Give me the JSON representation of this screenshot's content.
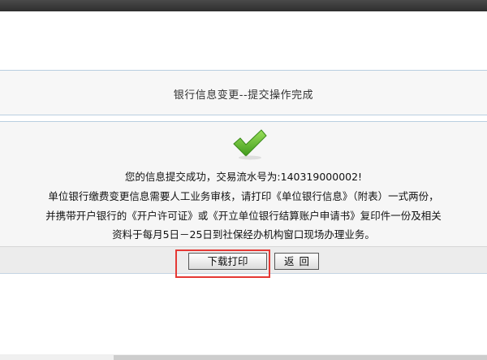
{
  "page": {
    "title": "银行信息变更--提交操作完成"
  },
  "result": {
    "line1": "您的信息提交成功，交易流水号为:140319000002!",
    "line2": "单位银行缴费变更信息需要人工业务审核，请打印《单位银行信息》（附表）一式两份，",
    "line3": "并携带开户银行的《开户许可证》或《开立单位银行结算账户申请书》复印件一份及相关",
    "line4": "资料于每月5日－25日到社保经办机构窗口现场办理业务。"
  },
  "buttons": {
    "download_print": "下载打印",
    "back": "返回"
  },
  "icons": {
    "success": "checkmark-icon"
  },
  "colors": {
    "check_green": "#5cb82e",
    "highlight_red": "#e53935",
    "panel_border": "#b9cfe0"
  }
}
